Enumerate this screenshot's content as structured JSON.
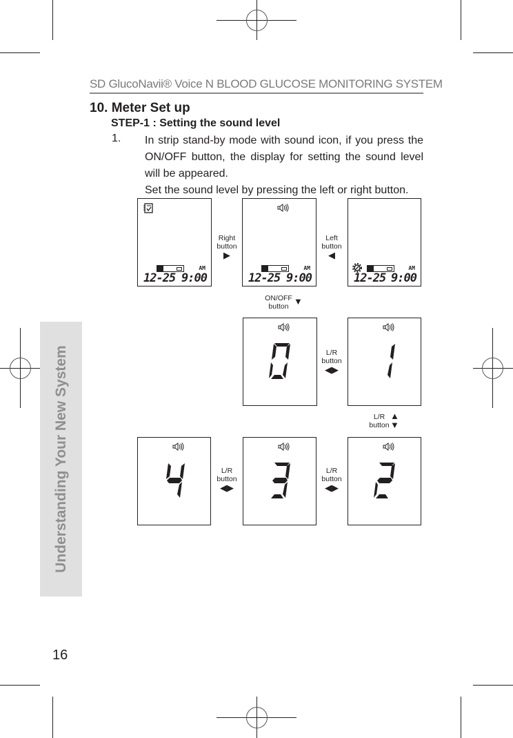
{
  "header": {
    "title": "SD GlucoNavii® Voice N BLOOD GLUCOSE MONITORING SYSTEM"
  },
  "section": {
    "title": "10. Meter Set up",
    "step": "STEP-1 : Setting the sound level",
    "item_number": "1.",
    "paragraph": "In strip stand-by mode with sound icon, if you press the ON/OFF button, the display for setting the sound level will be appeared.",
    "paragraph2": "Set the sound level by pressing the left or right button."
  },
  "side_tab": {
    "label": "Understanding Your New System"
  },
  "page_number": "16",
  "displays": {
    "standby": {
      "date": "12-25",
      "time": "9:00",
      "ampm": "AM",
      "icon": "logbook-check-icon"
    },
    "sound": {
      "date": "12-25",
      "time": "9:00",
      "ampm": "AM",
      "icon": "speaker-icon"
    },
    "settings": {
      "date": "12-25",
      "time": "9:00",
      "ampm": "AM",
      "icon": "gear-icon"
    },
    "levels": [
      "0",
      "1",
      "2",
      "3",
      "4"
    ]
  },
  "labels": {
    "right_button": [
      "Right",
      "button"
    ],
    "left_button": [
      "Left",
      "button"
    ],
    "onoff_button": [
      "ON/OFF",
      "button"
    ],
    "lr_button": [
      "L/R",
      "button"
    ]
  },
  "glyphs": {
    "right": "▶",
    "left": "◀",
    "down": "▼",
    "up": "▲",
    "speaker": "🔊"
  }
}
